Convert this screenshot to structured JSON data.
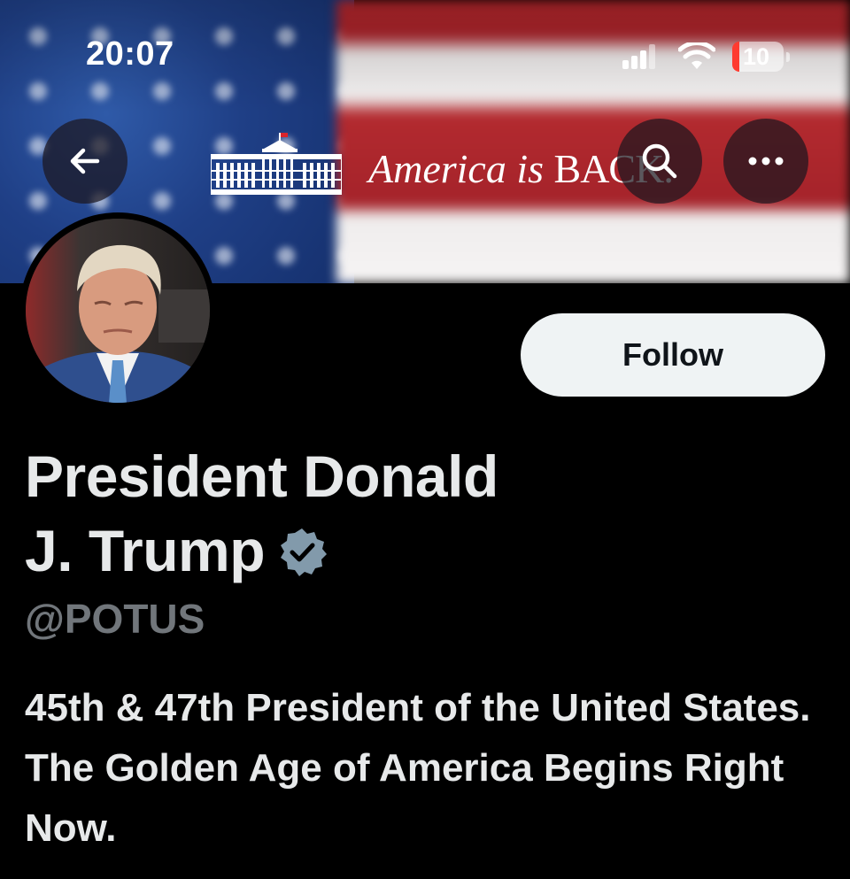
{
  "status_bar": {
    "time": "20:07",
    "battery": "10",
    "icons": [
      "signal-icon",
      "wifi-icon",
      "battery-icon"
    ]
  },
  "header": {
    "back_icon": "arrow-left-icon",
    "search_icon": "search-icon",
    "more_icon": "ellipsis-icon"
  },
  "banner": {
    "slogan_main": "America is ",
    "slogan_back": "BACK."
  },
  "profile": {
    "follow_label": "Follow",
    "name_line1": "President Donald",
    "name_line2": "J. Trump",
    "verified_icon": "verified-badge-icon",
    "handle": "@POTUS",
    "bio": "45th & 47th President of the United States. The Golden Age of America Begins Right Now."
  },
  "colors": {
    "background": "#000000",
    "text_primary": "#e7e9ea",
    "text_secondary": "#71767b",
    "follow_bg": "#eff3f4",
    "verified": "#829aab",
    "battery_low": "#ff3b30"
  }
}
